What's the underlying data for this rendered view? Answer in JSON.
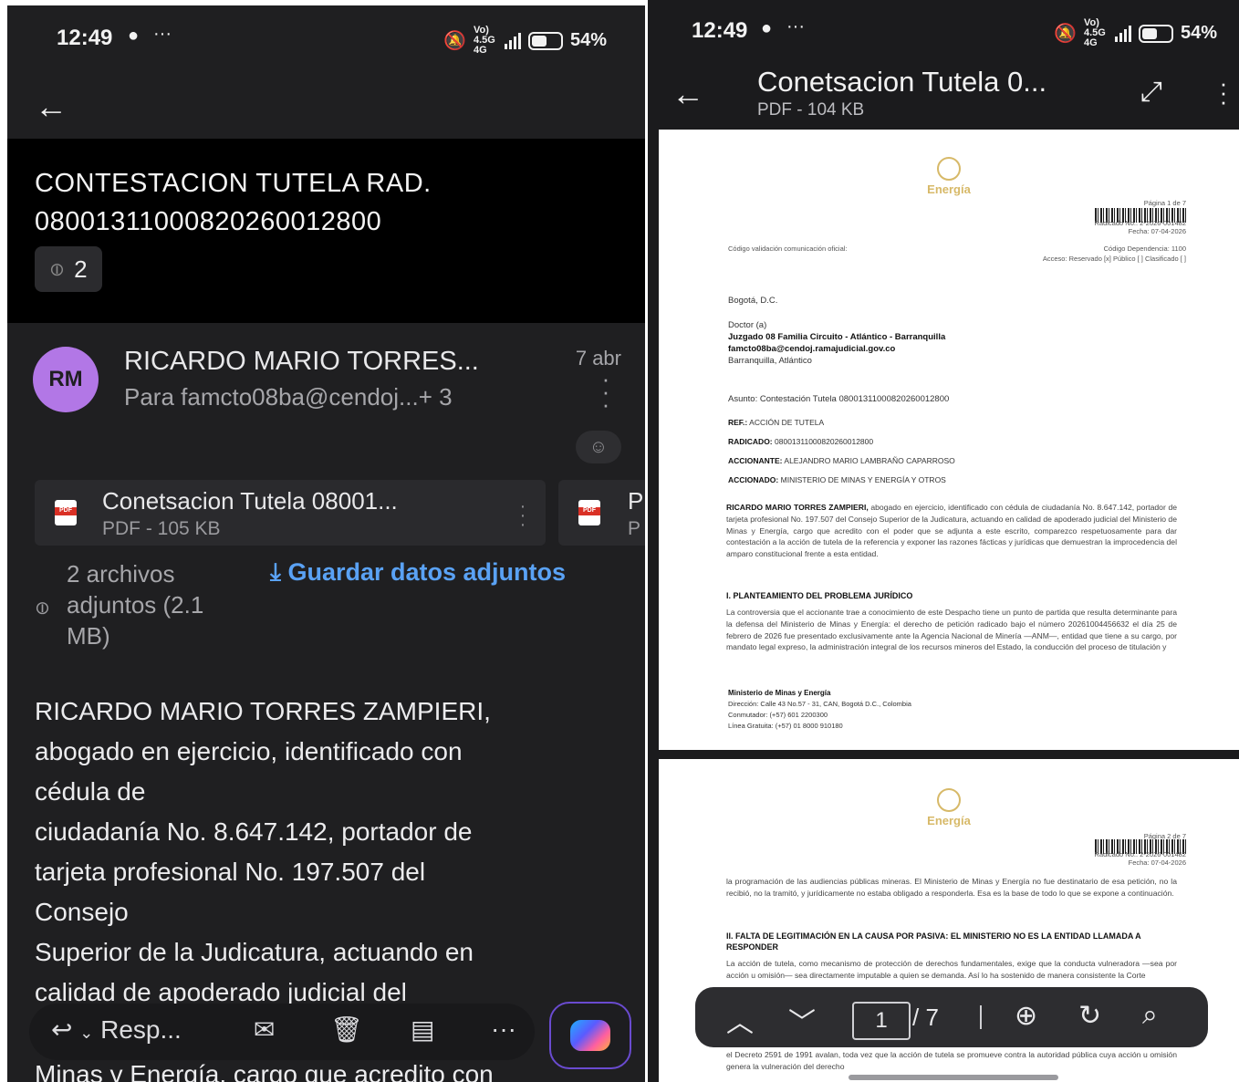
{
  "status_bar": {
    "time": "12:49",
    "battery": "54%",
    "network": "Vo) 4.5G 4G"
  },
  "email": {
    "subject": "CONTESTACION  TUTELA RAD. 08001311000820260012800",
    "attachment_count": "2",
    "sender": {
      "initials": "RM",
      "name": "RICARDO MARIO TORRES...",
      "to": "Para famcto08ba@cendoj...+ 3",
      "date": "7 abr"
    },
    "attachment": {
      "name": "Conetsacion Tutela 08001...",
      "size": "PDF - 105 KB",
      "second_letter": "P",
      "second_sub": "P"
    },
    "attachments_summary": "2 archivos adjuntos (2.1 MB)",
    "save_label": "Guardar datos adjuntos",
    "body_lines": [
      "RICARDO MARIO TORRES ZAMPIERI,",
      "abogado en ejercicio, identificado con",
      "cédula de",
      "ciudadanía No. 8.647.142, portador de",
      "tarjeta profesional No. 197.507 del",
      "Consejo",
      "Superior de la Judicatura, actuando en",
      "calidad de apoderado judicial del"
    ],
    "cutoff_line": "Minas y Energía, cargo que acredito con",
    "reply_label": "Resp..."
  },
  "pdf_viewer": {
    "title": "Conetsacion Tutela 0...",
    "subtitle": "PDF - 104 KB",
    "current_page": "1",
    "total_pages": "/ 7",
    "page1": {
      "logo": "Energía",
      "page_info": "Página 1 de 7",
      "radicado": "Radicado No.: 2-2026-001482",
      "fecha": "Fecha: 07-04-2026",
      "codigo_left": "Código validación comunicación oficial:",
      "codigo_right": "Código Dependencia: 1100",
      "acceso": "Acceso: Reservado [x]  Público [ ]  Clasificado [ ]",
      "city": "Bogotá, D.C.",
      "doctor": "Doctor (a)",
      "juzgado": "Juzgado 08 Familia Circuito - Atlántico - Barranquilla",
      "email": "famcto08ba@cendoj.ramajudicial.gov.co",
      "city2": "Barranquilla, Atlántico",
      "asunto": "Asunto: Contestación Tutela 08001311000820260012800",
      "ref_label": "REF.:",
      "ref": "ACCIÓN DE TUTELA",
      "radicado_label": "RADICADO:",
      "radicado_val": "08001311000820260012800",
      "accionante_label": "ACCIONANTE:",
      "accionante": "ALEJANDRO MARIO LAMBRAÑO CAPARROSO",
      "accionado_label": "ACCIONADO:",
      "accionado": "MINISTERIO DE MINAS Y ENERGÍA Y OTROS",
      "para1_bold": "RICARDO MARIO TORRES ZAMPIERI,",
      "para1": " abogado en ejercicio, identificado con cédula de ciudadanía No. 8.647.142, portador de tarjeta profesional No. 197.507 del Consejo Superior de la Judicatura, actuando en calidad de apoderado judicial del Ministerio de Minas y Energía, cargo que acredito con el poder que se adjunta a este escrito, comparezco respetuosamente para dar contestación a la acción de tutela de la referencia y exponer las razones fácticas y jurídicas que demuestran la improcedencia del amparo constitucional frente a esta entidad.",
      "heading1": "I. PLANTEAMIENTO DEL PROBLEMA JURÍDICO",
      "para2": "La controversia que el accionante trae a conocimiento de este Despacho tiene un punto de partida que resulta determinante para la defensa del Ministerio de Minas y Energía: el derecho de petición radicado bajo el número 20261004456632 el día 25 de febrero de 2026 fue presentado exclusivamente ante la Agencia Nacional de Minería —ANM—, entidad que tiene a su cargo, por mandato legal expreso, la administración integral de los recursos mineros del Estado, la conducción del proceso de titulación y",
      "footer_title": "Ministerio de Minas y Energía",
      "footer_dir": "Dirección: Calle 43 No.57 - 31, CAN, Bogotá D.C., Colombia",
      "footer_conm": "Conmutador: (+57) 601 2200300",
      "footer_linea": "Línea Gratuita: (+57) 01 8000 910180"
    },
    "page2": {
      "logo": "Energía",
      "page_info": "Página 2 de 7",
      "radicado": "Radicado No.: 2-2026-001482",
      "fecha": "Fecha: 07-04-2026",
      "para1": "la programación de las audiencias públicas mineras. El Ministerio de Minas y Energía no fue destinatario de esa petición, no la recibió, no la tramitó, y jurídicamente no estaba obligado a responderla. Esa es la base de todo lo que se expone a continuación.",
      "heading": "II. FALTA DE LEGITIMACIÓN EN LA CAUSA POR PASIVA: EL MINISTERIO NO ES LA ENTIDAD LLAMADA A RESPONDER",
      "para2": "La acción de tutela, como mecanismo de protección de derechos fundamentales, exige que la conducta vulneradora —sea por acción u omisión— sea directamente imputable a quien se demanda. Así lo ha sostenido de manera consistente la Corte",
      "para3": "el Decreto 2591 de 1991 avalan, toda vez que la acción de tutela se promueve contra la autoridad pública cuya acción u omisión genera la vulneración del derecho"
    }
  }
}
